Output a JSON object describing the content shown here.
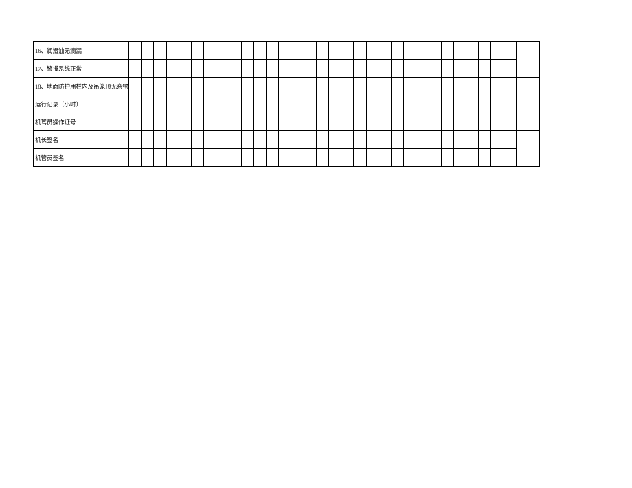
{
  "rows": [
    {
      "label": "16、润滑油无滴漏"
    },
    {
      "label": "17、警报系统正常"
    },
    {
      "label": "18、地面防护用栏内及吊笼顶无杂物"
    },
    {
      "label": "运行记录（小时）"
    },
    {
      "label": "机驾员操作证号"
    },
    {
      "label": "机长签名"
    },
    {
      "label": "机管员签名"
    }
  ],
  "columns_count": 31
}
